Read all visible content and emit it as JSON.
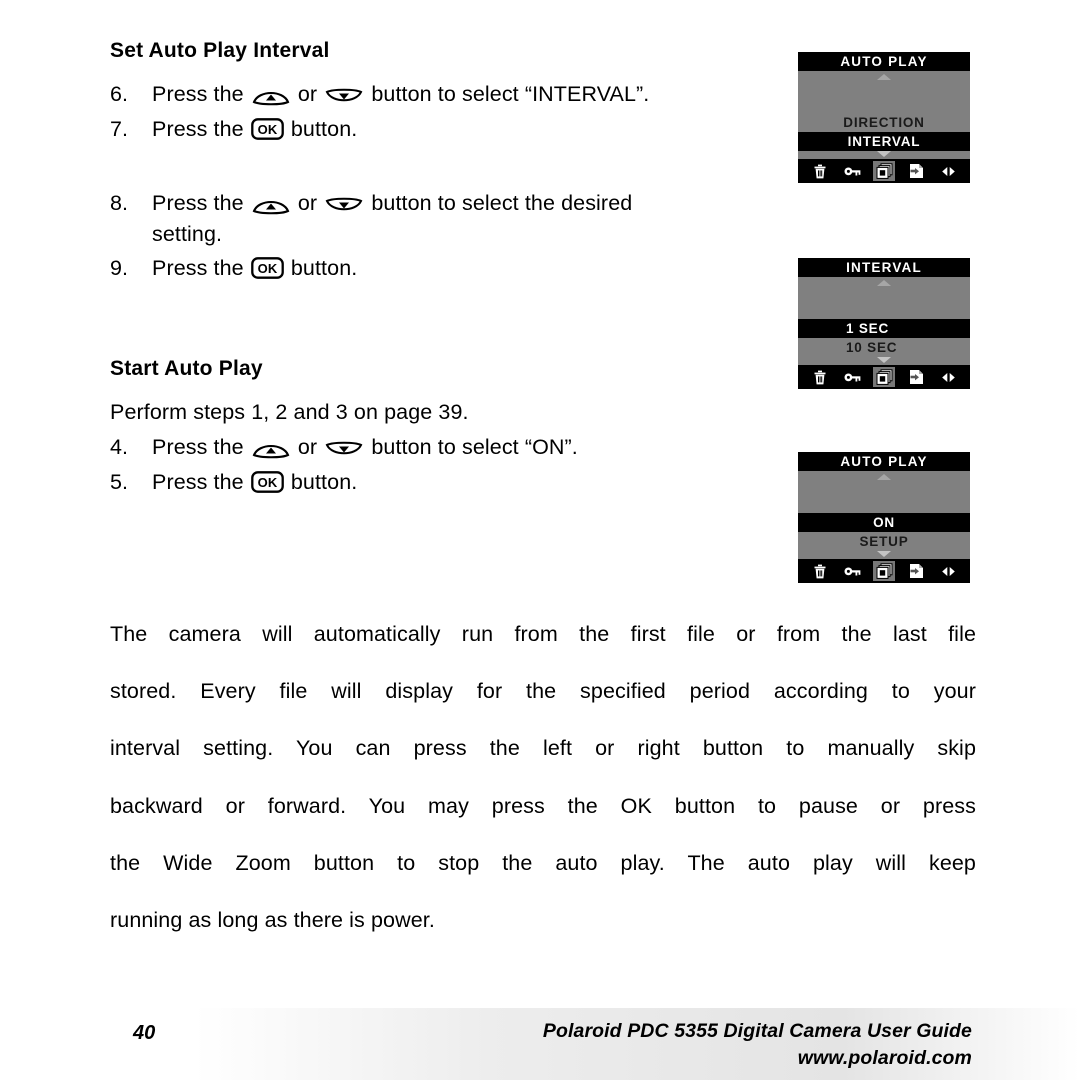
{
  "document": {
    "sections": [
      {
        "heading": "Set Auto Play Interval",
        "steps": [
          {
            "num": "6.",
            "pre": "Press the ",
            "mid": " or ",
            "post": " button to select “INTERVAL”."
          },
          {
            "num": "7.",
            "pre": "Press the ",
            "post": " button."
          }
        ]
      },
      {
        "heading": "",
        "steps": [
          {
            "num": "8.",
            "pre": "Press the ",
            "mid": " or ",
            "post": " button to select the desired",
            "cont": "setting."
          },
          {
            "num": "9.",
            "pre": "Press the ",
            "post": " button."
          }
        ]
      },
      {
        "heading": "Start Auto Play",
        "intro": "Perform steps 1, 2 and 3 on page 39.",
        "steps": [
          {
            "num": "4.",
            "pre": "Press the ",
            "mid": " or ",
            "post": " button to select “ON”."
          },
          {
            "num": "5.",
            "pre": "Press the ",
            "post": " button."
          }
        ]
      }
    ],
    "paragraph": {
      "lines": [
        "The camera will automatically run from the first file or from the last file",
        "stored. Every file will display for the specified period according to your",
        "interval setting. You can press the left or right button to manually skip",
        "backward or forward. You may press the OK button to pause or press",
        "the Wide Zoom button to stop the auto play. The auto play will keep",
        "running as long as there is power."
      ]
    }
  },
  "lcd_screens": [
    {
      "id": "auto-play-interval",
      "title": "AUTO PLAY",
      "rows": [
        {
          "label": "DIRECTION",
          "selected": false,
          "align": "center"
        },
        {
          "label": "INTERVAL",
          "selected": true,
          "align": "center"
        }
      ],
      "scroll_up": true,
      "scroll_down": true,
      "icons": [
        "trash-icon",
        "key-icon",
        "slideshow-icon",
        "transfer-icon",
        "left-right-icon"
      ],
      "active_icon_index": 2
    },
    {
      "id": "interval-values",
      "title": "INTERVAL",
      "rows": [
        {
          "label": "1 SEC",
          "selected": true,
          "align": "left"
        },
        {
          "label": "10 SEC",
          "selected": false,
          "align": "left"
        }
      ],
      "scroll_up": true,
      "scroll_down": true,
      "icons": [
        "trash-icon",
        "key-icon",
        "slideshow-icon",
        "transfer-icon",
        "left-right-icon"
      ],
      "active_icon_index": 2
    },
    {
      "id": "auto-play-on",
      "title": "AUTO PLAY",
      "rows": [
        {
          "label": "ON",
          "selected": true,
          "align": "center"
        },
        {
          "label": "SETUP",
          "selected": false,
          "align": "center"
        }
      ],
      "scroll_up": true,
      "scroll_down": true,
      "icons": [
        "trash-icon",
        "key-icon",
        "slideshow-icon",
        "transfer-icon",
        "left-right-icon"
      ],
      "active_icon_index": 2
    }
  ],
  "glyphs": {
    "ok_label": "OK",
    "up_button": "up-rocker-button-icon",
    "down_button": "down-rocker-button-icon"
  },
  "footer": {
    "page_number": "40",
    "title": "Polaroid PDC 5355 Digital Camera User Guide",
    "url": "www.polaroid.com"
  },
  "colors": {
    "lcd_background": "#808080",
    "lcd_selected_bar": "#000000",
    "lcd_selected_text": "#ffffff",
    "lcd_icon_bar": "#000000",
    "page_background": "#ffffff"
  }
}
